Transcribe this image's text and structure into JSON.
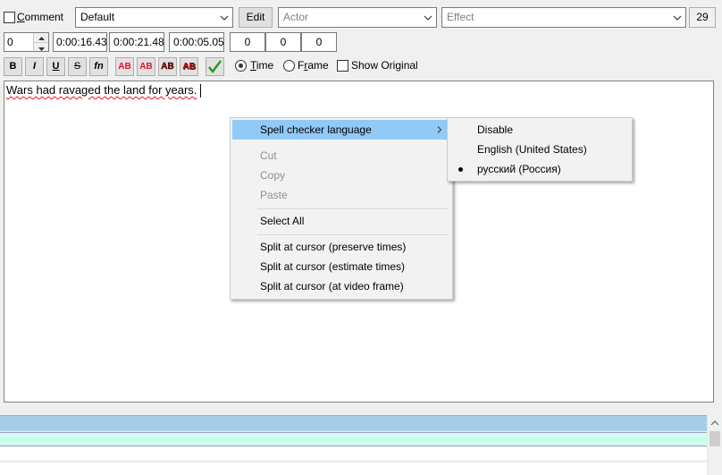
{
  "toolbar1": {
    "comment_label": "Comment",
    "style_value": "Default",
    "edit_label": "Edit",
    "actor_placeholder": "Actor",
    "effect_placeholder": "Effect",
    "char_count": "29"
  },
  "toolbar2": {
    "layer": "0",
    "start_time": "0:00:16.43",
    "end_time": "0:00:21.48",
    "duration": "0:00:05.05",
    "margin_left": "0",
    "margin_right": "0",
    "margin_vert": "0"
  },
  "toolbar3": {
    "bold": "B",
    "italic": "I",
    "underline": "U",
    "strikeout": "S",
    "font": "fn",
    "color1": "AB",
    "color2": "AB",
    "color3": "AB",
    "color4": "AB",
    "commit_icon": "checkmark-icon",
    "time_label": "Time",
    "frame_label": "Frame",
    "show_original_label": "Show Original",
    "time_mode": "time"
  },
  "editor": {
    "text": "Wars had ravaged the land for years."
  },
  "context_menu": {
    "spell_checker_language": "Spell checker language",
    "cut": "Cut",
    "copy": "Copy",
    "paste": "Paste",
    "select_all": "Select All",
    "split_preserve": "Split at cursor (preserve times)",
    "split_estimate": "Split at cursor (estimate times)",
    "split_frame": "Split at cursor (at video frame)"
  },
  "submenu": {
    "disable": "Disable",
    "english": "English (United States)",
    "russian": "русский (Россия)",
    "selected": "русский (Россия)"
  },
  "colors": {
    "highlight": "#91c9f7",
    "grid_selected": "#a6cde8",
    "grid_active": "#ccffee",
    "spell_error": "#e81123"
  }
}
